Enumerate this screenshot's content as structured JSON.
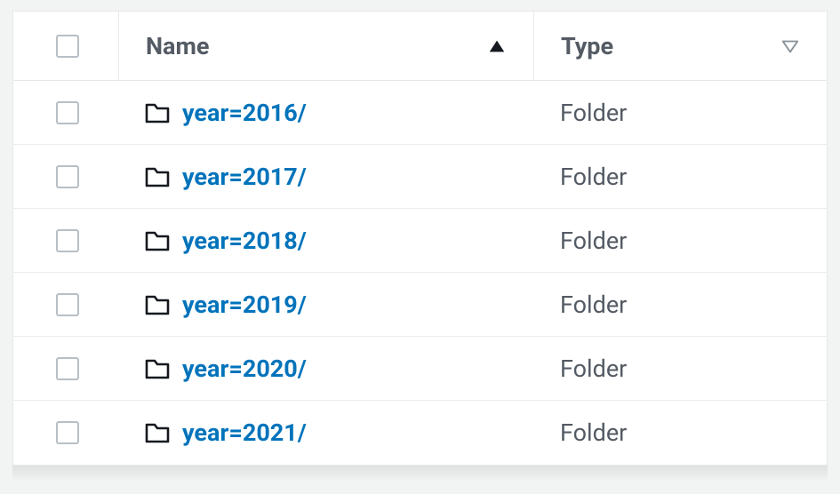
{
  "table": {
    "headers": {
      "name": "Name",
      "type": "Type"
    },
    "rows": [
      {
        "name": "year=2016/",
        "type": "Folder"
      },
      {
        "name": "year=2017/",
        "type": "Folder"
      },
      {
        "name": "year=2018/",
        "type": "Folder"
      },
      {
        "name": "year=2019/",
        "type": "Folder"
      },
      {
        "name": "year=2020/",
        "type": "Folder"
      },
      {
        "name": "year=2021/",
        "type": "Folder"
      }
    ],
    "sort": {
      "column": "name",
      "direction": "asc"
    }
  }
}
